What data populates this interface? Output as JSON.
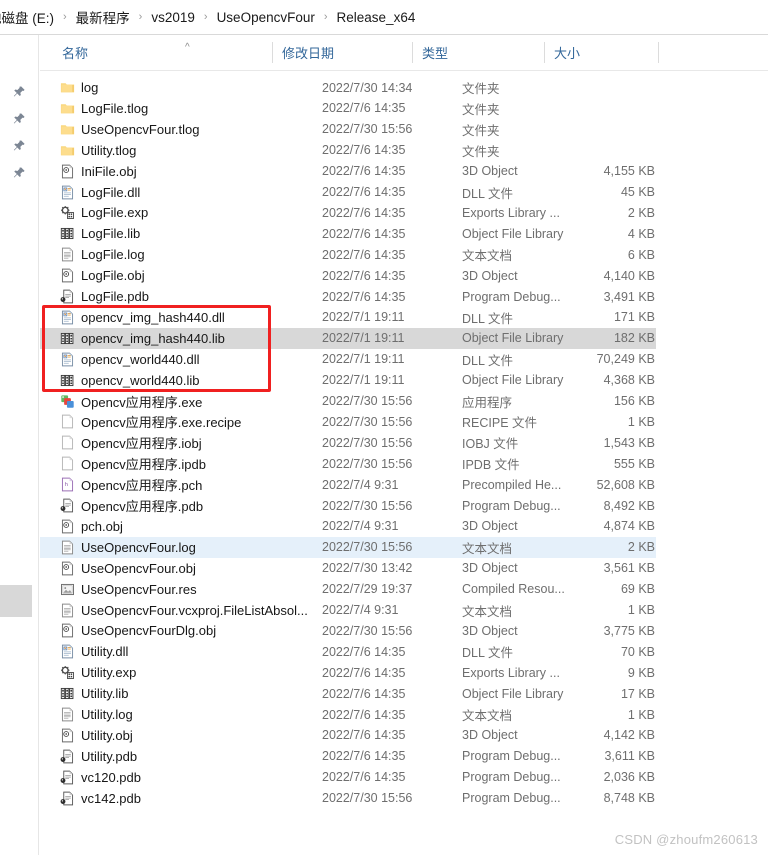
{
  "breadcrumb": {
    "items": [
      "地磁盘 (E:)",
      "最新程序",
      "vs2019",
      "UseOpencvFour",
      "Release_x64"
    ],
    "separator": "›"
  },
  "columns": {
    "name": "名称",
    "modified": "修改日期",
    "type": "类型",
    "size": "大小",
    "sort_caret": "^"
  },
  "colors": {
    "header_text": "#33679a",
    "selection_gray": "#d8d8d8",
    "selection_blue": "#e5f0fa",
    "annotation_red": "#f02020",
    "folder_yellow": "#f7d275"
  },
  "sidebar": {
    "pins": [
      "pin-icon",
      "pin-icon",
      "pin-icon",
      "pin-icon"
    ]
  },
  "files": [
    {
      "name": "log",
      "date": "2022/7/30 14:34",
      "type": "文件夹",
      "size": "",
      "icon": "folder",
      "sel": ""
    },
    {
      "name": "LogFile.tlog",
      "date": "2022/7/6 14:35",
      "type": "文件夹",
      "size": "",
      "icon": "folder",
      "sel": ""
    },
    {
      "name": "UseOpencvFour.tlog",
      "date": "2022/7/30 15:56",
      "type": "文件夹",
      "size": "",
      "icon": "folder",
      "sel": ""
    },
    {
      "name": "Utility.tlog",
      "date": "2022/7/6 14:35",
      "type": "文件夹",
      "size": "",
      "icon": "folder",
      "sel": ""
    },
    {
      "name": "IniFile.obj",
      "date": "2022/7/6 14:35",
      "type": "3D Object",
      "size": "4,155 KB",
      "icon": "obj",
      "sel": ""
    },
    {
      "name": "LogFile.dll",
      "date": "2022/7/6 14:35",
      "type": "DLL 文件",
      "size": "45 KB",
      "icon": "dll",
      "sel": ""
    },
    {
      "name": "LogFile.exp",
      "date": "2022/7/6 14:35",
      "type": "Exports Library ...",
      "size": "2 KB",
      "icon": "exp",
      "sel": ""
    },
    {
      "name": "LogFile.lib",
      "date": "2022/7/6 14:35",
      "type": "Object File Library",
      "size": "4 KB",
      "icon": "lib",
      "sel": ""
    },
    {
      "name": "LogFile.log",
      "date": "2022/7/6 14:35",
      "type": "文本文档",
      "size": "6 KB",
      "icon": "txt",
      "sel": ""
    },
    {
      "name": "LogFile.obj",
      "date": "2022/7/6 14:35",
      "type": "3D Object",
      "size": "4,140 KB",
      "icon": "obj",
      "sel": ""
    },
    {
      "name": "LogFile.pdb",
      "date": "2022/7/6 14:35",
      "type": "Program Debug...",
      "size": "3,491 KB",
      "icon": "pdb",
      "sel": ""
    },
    {
      "name": "opencv_img_hash440.dll",
      "date": "2022/7/1 19:11",
      "type": "DLL 文件",
      "size": "171 KB",
      "icon": "dll",
      "sel": ""
    },
    {
      "name": "opencv_img_hash440.lib",
      "date": "2022/7/1 19:11",
      "type": "Object File Library",
      "size": "182 KB",
      "icon": "lib",
      "sel": "gray"
    },
    {
      "name": "opencv_world440.dll",
      "date": "2022/7/1 19:11",
      "type": "DLL 文件",
      "size": "70,249 KB",
      "icon": "dll",
      "sel": ""
    },
    {
      "name": "opencv_world440.lib",
      "date": "2022/7/1 19:11",
      "type": "Object File Library",
      "size": "4,368 KB",
      "icon": "lib",
      "sel": ""
    },
    {
      "name": "Opencv应用程序.exe",
      "date": "2022/7/30 15:56",
      "type": "应用程序",
      "size": "156 KB",
      "icon": "exe",
      "sel": ""
    },
    {
      "name": "Opencv应用程序.exe.recipe",
      "date": "2022/7/30 15:56",
      "type": "RECIPE 文件",
      "size": "1 KB",
      "icon": "blank",
      "sel": ""
    },
    {
      "name": "Opencv应用程序.iobj",
      "date": "2022/7/30 15:56",
      "type": "IOBJ 文件",
      "size": "1,543 KB",
      "icon": "blank",
      "sel": ""
    },
    {
      "name": "Opencv应用程序.ipdb",
      "date": "2022/7/30 15:56",
      "type": "IPDB 文件",
      "size": "555 KB",
      "icon": "blank",
      "sel": ""
    },
    {
      "name": "Opencv应用程序.pch",
      "date": "2022/7/4 9:31",
      "type": "Precompiled He...",
      "size": "52,608 KB",
      "icon": "pch",
      "sel": ""
    },
    {
      "name": "Opencv应用程序.pdb",
      "date": "2022/7/30 15:56",
      "type": "Program Debug...",
      "size": "8,492 KB",
      "icon": "pdb",
      "sel": ""
    },
    {
      "name": "pch.obj",
      "date": "2022/7/4 9:31",
      "type": "3D Object",
      "size": "4,874 KB",
      "icon": "obj",
      "sel": ""
    },
    {
      "name": "UseOpencvFour.log",
      "date": "2022/7/30 15:56",
      "type": "文本文档",
      "size": "2 KB",
      "icon": "txt",
      "sel": "blue"
    },
    {
      "name": "UseOpencvFour.obj",
      "date": "2022/7/30 13:42",
      "type": "3D Object",
      "size": "3,561 KB",
      "icon": "obj",
      "sel": ""
    },
    {
      "name": "UseOpencvFour.res",
      "date": "2022/7/29 19:37",
      "type": "Compiled Resou...",
      "size": "69 KB",
      "icon": "res",
      "sel": ""
    },
    {
      "name": "UseOpencvFour.vcxproj.FileListAbsol...",
      "date": "2022/7/4 9:31",
      "type": "文本文档",
      "size": "1 KB",
      "icon": "txt",
      "sel": ""
    },
    {
      "name": "UseOpencvFourDlg.obj",
      "date": "2022/7/30 15:56",
      "type": "3D Object",
      "size": "3,775 KB",
      "icon": "obj",
      "sel": ""
    },
    {
      "name": "Utility.dll",
      "date": "2022/7/6 14:35",
      "type": "DLL 文件",
      "size": "70 KB",
      "icon": "dll",
      "sel": ""
    },
    {
      "name": "Utility.exp",
      "date": "2022/7/6 14:35",
      "type": "Exports Library ...",
      "size": "9 KB",
      "icon": "exp",
      "sel": ""
    },
    {
      "name": "Utility.lib",
      "date": "2022/7/6 14:35",
      "type": "Object File Library",
      "size": "17 KB",
      "icon": "lib",
      "sel": ""
    },
    {
      "name": "Utility.log",
      "date": "2022/7/6 14:35",
      "type": "文本文档",
      "size": "1 KB",
      "icon": "txt",
      "sel": ""
    },
    {
      "name": "Utility.obj",
      "date": "2022/7/6 14:35",
      "type": "3D Object",
      "size": "4,142 KB",
      "icon": "obj",
      "sel": ""
    },
    {
      "name": "Utility.pdb",
      "date": "2022/7/6 14:35",
      "type": "Program Debug...",
      "size": "3,611 KB",
      "icon": "pdb",
      "sel": ""
    },
    {
      "name": "vc120.pdb",
      "date": "2022/7/6 14:35",
      "type": "Program Debug...",
      "size": "2,036 KB",
      "icon": "pdb",
      "sel": ""
    },
    {
      "name": "vc142.pdb",
      "date": "2022/7/30 15:56",
      "type": "Program Debug...",
      "size": "8,748 KB",
      "icon": "pdb",
      "sel": ""
    }
  ],
  "annotation": {
    "label": "red-highlight-box",
    "first_row_index": 11,
    "row_count": 4
  },
  "watermark": {
    "text": "CSDN @zhoufm260613"
  }
}
